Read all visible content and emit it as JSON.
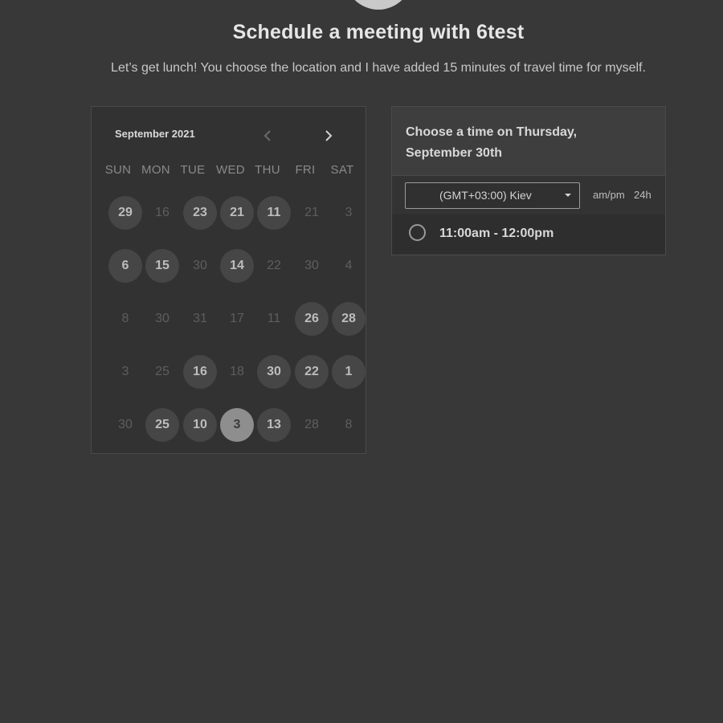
{
  "header": {
    "title": "Schedule a meeting with 6test",
    "subtitle": "Let’s get lunch! You choose the location and I have added 15 minutes of travel time for myself."
  },
  "calendar": {
    "month_label": "September 2021",
    "prev_icon": "chevron-left-icon",
    "next_icon": "chevron-right-icon",
    "weekdays": [
      "SUN",
      "MON",
      "TUE",
      "WED",
      "THU",
      "FRI",
      "SAT"
    ],
    "weeks": [
      [
        {
          "label": "29",
          "state": "available"
        },
        {
          "label": "16",
          "state": "disabled"
        },
        {
          "label": "23",
          "state": "available"
        },
        {
          "label": "21",
          "state": "available"
        },
        {
          "label": "11",
          "state": "available"
        },
        {
          "label": "21",
          "state": "disabled"
        },
        {
          "label": "3",
          "state": "disabled"
        }
      ],
      [
        {
          "label": "6",
          "state": "available"
        },
        {
          "label": "15",
          "state": "available"
        },
        {
          "label": "30",
          "state": "disabled"
        },
        {
          "label": "14",
          "state": "available"
        },
        {
          "label": "22",
          "state": "disabled"
        },
        {
          "label": "30",
          "state": "disabled"
        },
        {
          "label": "4",
          "state": "disabled"
        }
      ],
      [
        {
          "label": "8",
          "state": "disabled"
        },
        {
          "label": "30",
          "state": "disabled"
        },
        {
          "label": "31",
          "state": "disabled"
        },
        {
          "label": "17",
          "state": "disabled"
        },
        {
          "label": "11",
          "state": "disabled"
        },
        {
          "label": "26",
          "state": "available"
        },
        {
          "label": "28",
          "state": "available"
        }
      ],
      [
        {
          "label": "3",
          "state": "disabled"
        },
        {
          "label": "25",
          "state": "disabled"
        },
        {
          "label": "16",
          "state": "available"
        },
        {
          "label": "18",
          "state": "disabled"
        },
        {
          "label": "30",
          "state": "available"
        },
        {
          "label": "22",
          "state": "available"
        },
        {
          "label": "1",
          "state": "available"
        }
      ],
      [
        {
          "label": "30",
          "state": "disabled"
        },
        {
          "label": "25",
          "state": "available"
        },
        {
          "label": "10",
          "state": "available"
        },
        {
          "label": "3",
          "state": "selected"
        },
        {
          "label": "13",
          "state": "available"
        },
        {
          "label": "28",
          "state": "disabled"
        },
        {
          "label": "8",
          "state": "disabled"
        }
      ]
    ]
  },
  "time_panel": {
    "heading": "Choose a time on Thursday, September 30th",
    "timezone": "(GMT+03:00) Kiev",
    "format_ampm": "am/pm",
    "format_24h": "24h",
    "slots": [
      {
        "label": "11:00am - 12:00pm"
      }
    ]
  },
  "colors": {
    "background": "#383838",
    "available_day": "#464646",
    "selected_day": "#8e8e8e"
  }
}
